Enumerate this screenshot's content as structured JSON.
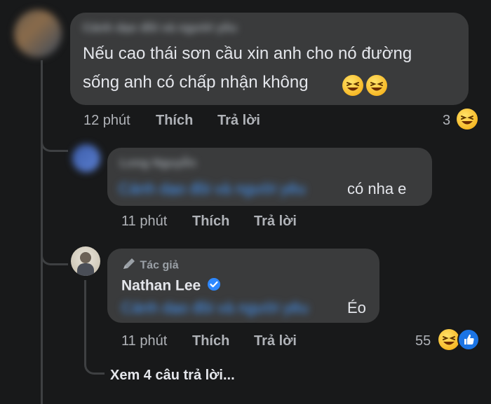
{
  "comment1": {
    "author_blurred": "Cánh dạo đồi và người yêu",
    "text_line1": "Nếu cao thái sơn cầu xin anh cho nó đường",
    "text_line2": "sống anh có chấp nhận không",
    "inline_emojis": [
      "laughing-emoji",
      "laughing-emoji"
    ],
    "time": "12 phút",
    "like_label": "Thích",
    "reply_label": "Trả lời",
    "reaction_count": "3",
    "reaction_icon": "laughing-emoji"
  },
  "reply1": {
    "author_blurred": "Long Nguyễn",
    "mention_blurred": "Cánh dạo đồi và người yêu",
    "text": "có nha e",
    "time": "11 phút",
    "like_label": "Thích",
    "reply_label": "Trả lời"
  },
  "reply2": {
    "author_badge": "Tác giả",
    "author": "Nathan Lee",
    "verified": true,
    "mention_blurred": "Cánh dạo đồi và người yêu",
    "text_suffix": "Éo",
    "time": "11 phút",
    "like_label": "Thích",
    "reply_label": "Trả lời",
    "reaction_count": "55",
    "reaction_icons": [
      "laughing-emoji",
      "like-icon"
    ]
  },
  "view_more": "Xem 4 câu trả lời...",
  "colors": {
    "background": "#18191a",
    "bubble": "#3a3b3c",
    "primary_text": "#e4e6eb",
    "secondary_text": "#b0b3b8",
    "link": "#4599ff",
    "verified": "#2d88ff"
  }
}
